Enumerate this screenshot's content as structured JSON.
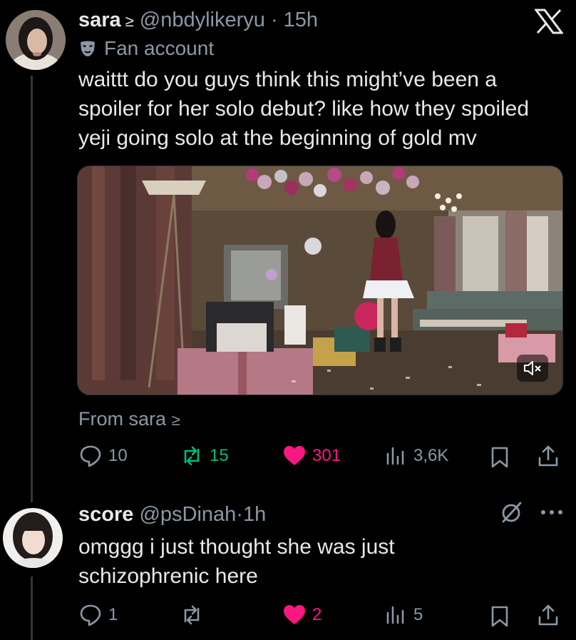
{
  "app": {
    "logo_icon": "x-logo-icon"
  },
  "tweet": {
    "name": "sara",
    "name_suffix": "≥",
    "handle": "@nbdylikeryu",
    "separator": "·",
    "time": "15h",
    "label": "Fan account",
    "label_icon": "mask-icon",
    "text_lines": [
      "waittt do you guys think this might’ve been a",
      "spoiler for her solo debut? like how they spoiled",
      "yeji going solo at the beginning of gold mv"
    ],
    "media": {
      "type": "video-still",
      "mute_icon": "volume-muted-icon"
    },
    "from_prefix": "From",
    "from_name": "sara",
    "from_suffix": "≥",
    "actions": {
      "replies": "10",
      "reposts": "15",
      "likes": "301",
      "views": "3,6K"
    },
    "colors": {
      "repost_active": "#00ba7c",
      "like_active": "#f91880",
      "muted": "#8b98a5"
    }
  },
  "reply": {
    "name": "score",
    "handle": "@psDinah",
    "separator": "·",
    "time": "1h",
    "text_lines": [
      "omggg i just thought she was just",
      "schizophrenic here"
    ],
    "actions": {
      "replies": "1",
      "reposts": "",
      "likes": "2",
      "views": "5"
    }
  }
}
